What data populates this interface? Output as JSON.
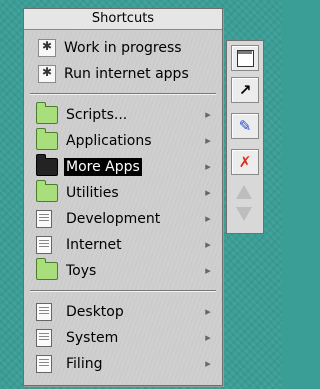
{
  "menu": {
    "title": "Shortcuts",
    "top_items": [
      {
        "label": "Work in progress",
        "icon": "app-star-icon"
      },
      {
        "label": "Run internet apps",
        "icon": "app-star-icon"
      }
    ],
    "middle_items": [
      {
        "label": "Scripts...",
        "icon": "folder-icon",
        "submenu": true
      },
      {
        "label": "Applications",
        "icon": "folder-icon",
        "submenu": true
      },
      {
        "label": "More Apps",
        "icon": "folder-open-icon",
        "submenu": true,
        "selected": true
      },
      {
        "label": "Utilities",
        "icon": "folder-icon",
        "submenu": true
      },
      {
        "label": "Development",
        "icon": "document-icon",
        "submenu": true
      },
      {
        "label": "Internet",
        "icon": "document-icon",
        "submenu": true
      },
      {
        "label": "Toys",
        "icon": "folder-icon",
        "submenu": true
      }
    ],
    "bottom_items": [
      {
        "label": "Desktop",
        "icon": "document-icon",
        "submenu": true
      },
      {
        "label": "System",
        "icon": "document-icon",
        "submenu": true
      },
      {
        "label": "Filing",
        "icon": "document-icon",
        "submenu": true
      }
    ],
    "submenu_arrow": "▸"
  },
  "toolbar": {
    "buttons": [
      {
        "name": "window-icon",
        "glyph": ""
      },
      {
        "name": "back-arrow-icon",
        "glyph": "↗"
      },
      {
        "name": "pencil-icon",
        "glyph": "✎"
      },
      {
        "name": "close-icon",
        "glyph": "✗"
      }
    ]
  },
  "colors": {
    "desktop": "#3a9e96",
    "menu_bg": "#cfcfcf",
    "folder": "#a9de7d",
    "selection": "#000000"
  }
}
